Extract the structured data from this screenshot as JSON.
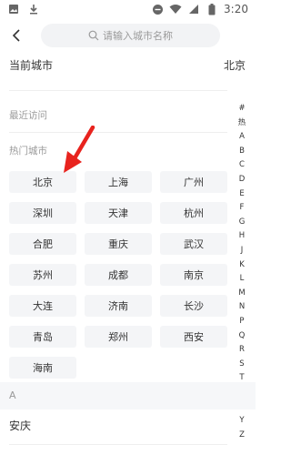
{
  "status_bar": {
    "time": "3:20",
    "icons": [
      "image-icon",
      "download-icon",
      "minus-circle-icon",
      "wifi-icon",
      "signal-icon",
      "battery-icon"
    ]
  },
  "header": {
    "back_icon": "chevron-left-icon",
    "search_placeholder": "请输入城市名称",
    "search_icon": "search-icon"
  },
  "current": {
    "label": "当前城市",
    "city": "北京"
  },
  "recent": {
    "label": "最近访问"
  },
  "hot": {
    "label": "热门城市",
    "cities": [
      "北京",
      "上海",
      "广州",
      "深圳",
      "天津",
      "杭州",
      "合肥",
      "重庆",
      "武汉",
      "苏州",
      "成都",
      "南京",
      "大连",
      "济南",
      "长沙",
      "青岛",
      "郑州",
      "西安",
      "海南"
    ]
  },
  "index_bar": [
    "#",
    "热",
    "A",
    "B",
    "C",
    "D",
    "E",
    "F",
    "G",
    "H",
    "J",
    "K",
    "L",
    "M",
    "N",
    "P",
    "Q",
    "R",
    "S",
    "T",
    "W",
    "X",
    "Y",
    "Z"
  ],
  "group": {
    "letter": "A",
    "first_city": "安庆"
  },
  "colors": {
    "accent_arrow": "#e8231e",
    "chip_bg": "#f4f5f7",
    "search_bg": "#f2f3f5"
  }
}
